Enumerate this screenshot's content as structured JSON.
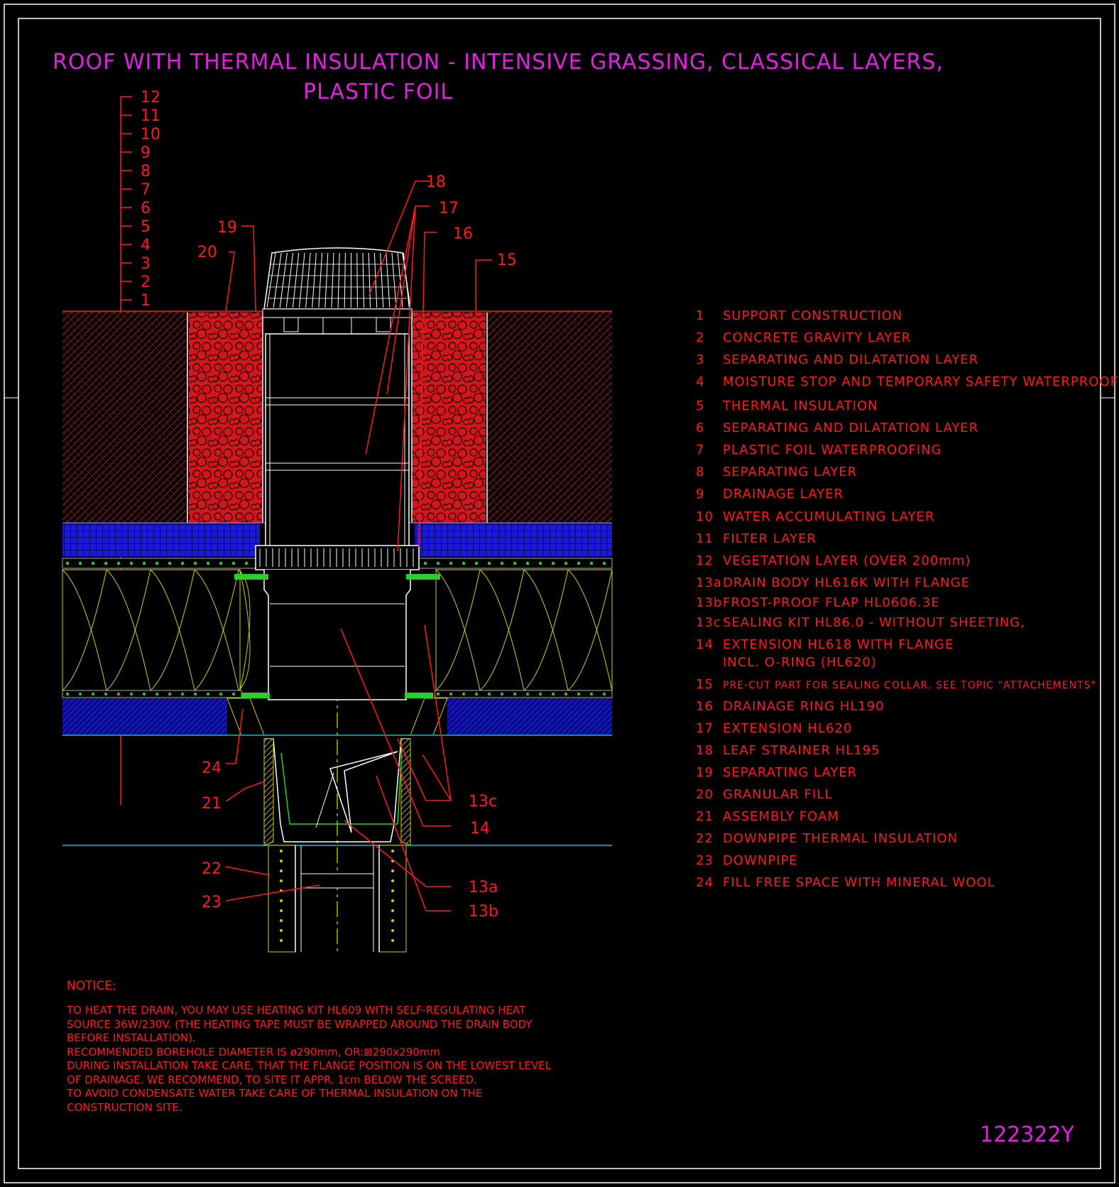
{
  "title": {
    "line1": "ROOF WITH THERMAL INSULATION - INTENSIVE GRASSING, CLASSICAL LAYERS,",
    "line2": "PLASTIC FOIL"
  },
  "layer_scale": [
    "12",
    "11",
    "10",
    "9",
    "8",
    "7",
    "6",
    "5",
    "4",
    "3",
    "2",
    "1"
  ],
  "callouts": {
    "c13a": "13a",
    "c13b": "13b",
    "c13c": "13c",
    "c14": "14",
    "c15": "15",
    "c16": "16",
    "c17": "17",
    "c18": "18",
    "c19": "19",
    "c20": "20",
    "c21": "21",
    "c22": "22",
    "c23": "23",
    "c24": "24"
  },
  "legend": [
    {
      "num": "1",
      "text": "SUPPORT CONSTRUCTION"
    },
    {
      "num": "2",
      "text": "CONCRETE GRAVITY LAYER"
    },
    {
      "num": "3",
      "text": "SEPARATING AND DILATATION LAYER"
    },
    {
      "num": "4",
      "text": "MOISTURE STOP AND TEMPORARY SAFETY WATERPROOFING"
    },
    {
      "num": "5",
      "text": "THERMAL INSULATION"
    },
    {
      "num": "6",
      "text": "SEPARATING AND DILATATION LAYER"
    },
    {
      "num": "7",
      "text": "PLASTIC FOIL WATERPROOFING"
    },
    {
      "num": "8",
      "text": "SEPARATING LAYER"
    },
    {
      "num": "9",
      "text": "DRAINAGE LAYER"
    },
    {
      "num": "10",
      "text": "WATER ACCUMULATING LAYER"
    },
    {
      "num": "11",
      "text": "FILTER LAYER"
    },
    {
      "num": "12",
      "text": "VEGETATION LAYER (OVER 200mm)"
    },
    {
      "num": "13a",
      "text": "DRAIN BODY HL616K WITH FLANGE"
    },
    {
      "num": "13b",
      "text": "FROST-PROOF FLAP HL0606.3E"
    },
    {
      "num": "13c",
      "text": "SEALING KIT HL86.0 - WITHOUT SHEETING,"
    },
    {
      "num": "14",
      "text": "EXTENSION HL618 WITH FLANGE"
    },
    {
      "num": "",
      "text": "INCL. O-RING (HL620)"
    },
    {
      "num": "15",
      "text": "PRE-CUT PART FOR SEALING COLLAR, SEE TOPIC \"ATTACHEMENTS\""
    },
    {
      "num": "16",
      "text": "DRAINAGE RING HL190"
    },
    {
      "num": "17",
      "text": "EXTENSION HL620"
    },
    {
      "num": "18",
      "text": "LEAF STRAINER HL195"
    },
    {
      "num": "19",
      "text": "SEPARATING LAYER"
    },
    {
      "num": "20",
      "text": "GRANULAR FILL"
    },
    {
      "num": "21",
      "text": "ASSEMBLY FOAM"
    },
    {
      "num": "22",
      "text": "DOWNPIPE THERMAL INSULATION"
    },
    {
      "num": "23",
      "text": "DOWNPIPE"
    },
    {
      "num": "24",
      "text": "FILL FREE SPACE WITH MINERAL WOOL"
    }
  ],
  "notice": {
    "heading": "NOTICE:",
    "lines": [
      "TO HEAT THE DRAIN, YOU MAY USE HEATING KIT HL609 WITH SELF-REGULATING HEAT",
      "SOURCE 36W/230V. (THE HEATING TAPE MUST BE WRAPPED AROUND THE DRAIN BODY",
      "BEFORE INSTALLATION).",
      "RECOMMENDED BOREHOLE DIAMETER IS ø290mm, OR:⊠290x290mm",
      "DURING INSTALLATION TAKE CARE, THAT THE FLANGE POSITION IS ON THE LOWEST LEVEL",
      "OF DRAINAGE. WE RECOMMEND, TO SITE IT APPR. 1cm BELOW THE SCREED.",
      "TO AVOID CONDENSATE WATER TAKE CARE OF THERMAL INSULATION ON THE",
      "CONSTRUCTION SITE."
    ]
  },
  "drawing_code": "122322Y",
  "colors": {
    "background": "#000000",
    "frame": "#ffffff",
    "title": "#e020e0",
    "annotation": "#ff1a1a",
    "insulation": "#e0e000",
    "drainage": "#1010e0",
    "foil": "#20e020",
    "baseline": "#00c0c0",
    "axis": "#e0e000"
  }
}
